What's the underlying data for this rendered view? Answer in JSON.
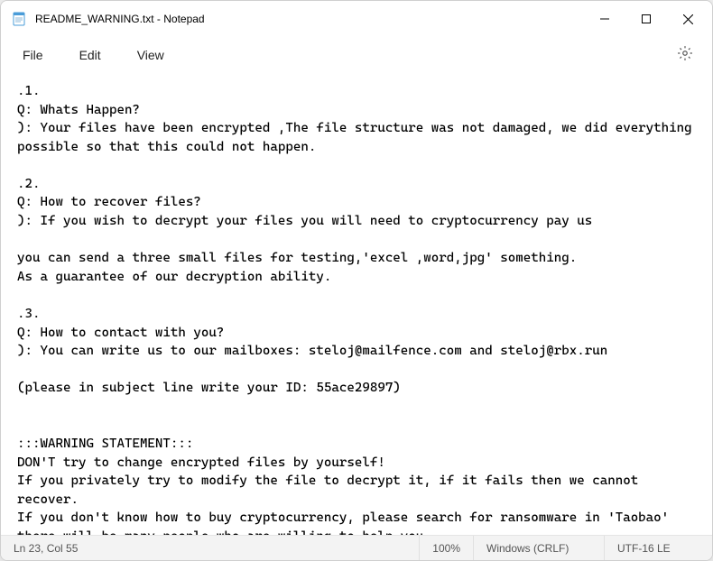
{
  "titlebar": {
    "title": "README_WARNING.txt - Notepad"
  },
  "menu": {
    "file": "File",
    "edit": "Edit",
    "view": "View"
  },
  "content": {
    "text": ".1.\nQ: Whats Happen?\n): Your files have been encrypted ,The file structure was not damaged, we did everything possible so that this could not happen.\n\n.2.\nQ: How to recover files?\n): If you wish to decrypt your files you will need to cryptocurrency pay us\n\nyou can send a three small files for testing,'excel ,word,jpg' something.\nAs a guarantee of our decryption ability.\n\n.3.\nQ: How to contact with you?\n): You can write us to our mailboxes: steloj@mailfence.com and steloj@rbx.run\n\n(please in subject line write your ID: 55ace29897)\n\n\n:::WARNING STATEMENT:::\nDON'T try to change encrypted files by yourself!\nIf you privately try to modify the file to decrypt it, if it fails then we cannot recover.\nIf you don't know how to buy cryptocurrency, please search for ransomware in 'Taobao' there will be many people who are willing to help you."
  },
  "statusbar": {
    "position": "Ln 23, Col 55",
    "zoom": "100%",
    "line_ending": "Windows (CRLF)",
    "encoding": "UTF-16 LE"
  }
}
